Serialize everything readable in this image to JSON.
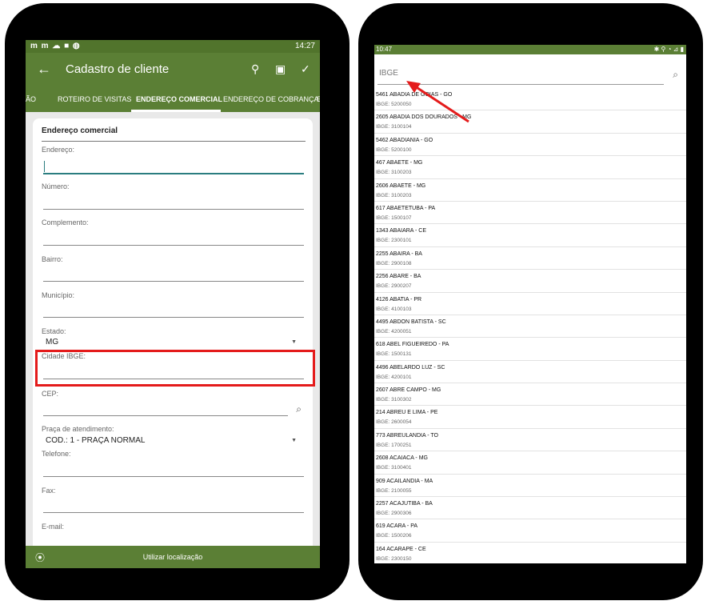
{
  "left": {
    "status": {
      "icons": "m m ☁ ■ ◍",
      "time": "14:27"
    },
    "appbar": {
      "title": "Cadastro de cliente"
    },
    "tabs": [
      "ÃO",
      "ROTEIRO DE VISITAS",
      "ENDEREÇO COMERCIAL",
      "ENDEREÇO DE COBRANÇA",
      "E"
    ],
    "section_title": "Endereço comercial",
    "fields": {
      "endereco": "Endereço:",
      "numero": "Número:",
      "complemento": "Complemento:",
      "bairro": "Bairro:",
      "municipio": "Município:",
      "estado_label": "Estado:",
      "estado_value": "MG",
      "cidade_ibge": "Cidade IBGE:",
      "cep": "CEP:",
      "praca_label": "Praça de atendimento:",
      "praca_value": "COD.: 1 - PRAÇA NORMAL",
      "telefone": "Telefone:",
      "fax": "Fax:",
      "email": "E-mail:"
    },
    "location_button": "Utilizar localização"
  },
  "right": {
    "status": {
      "time": "10:47",
      "right": "✱ ⚲ ◔ ⊿ ▮"
    },
    "search_placeholder": "IBGE",
    "cities": [
      {
        "name": "5461 ABADIA DE GOIAS - GO",
        "ibge": "IBGE: 5200050"
      },
      {
        "name": "2605 ABADIA DOS DOURADOS - MG",
        "ibge": "IBGE: 3100104"
      },
      {
        "name": "5462 ABADIANIA - GO",
        "ibge": "IBGE: 5200100"
      },
      {
        "name": "467 ABAETE - MG",
        "ibge": "IBGE: 3100203"
      },
      {
        "name": "2606 ABAETE - MG",
        "ibge": "IBGE: 3100203"
      },
      {
        "name": "617 ABAETETUBA - PA",
        "ibge": "IBGE: 1500107"
      },
      {
        "name": "1343 ABAIARA - CE",
        "ibge": "IBGE: 2300101"
      },
      {
        "name": "2255 ABAIRA - BA",
        "ibge": "IBGE: 2900108"
      },
      {
        "name": "2256 ABARE - BA",
        "ibge": "IBGE: 2900207"
      },
      {
        "name": "4126 ABATIA - PR",
        "ibge": "IBGE: 4100103"
      },
      {
        "name": "4495 ABDON BATISTA - SC",
        "ibge": "IBGE: 4200051"
      },
      {
        "name": "618 ABEL FIGUEIREDO - PA",
        "ibge": "IBGE: 1500131"
      },
      {
        "name": "4496 ABELARDO LUZ - SC",
        "ibge": "IBGE: 4200101"
      },
      {
        "name": "2607 ABRE CAMPO - MG",
        "ibge": "IBGE: 3100302"
      },
      {
        "name": "214 ABREU E LIMA - PE",
        "ibge": "IBGE: 2600054"
      },
      {
        "name": "773 ABREULANDIA - TO",
        "ibge": "IBGE: 1700251"
      },
      {
        "name": "2608 ACAIACA - MG",
        "ibge": "IBGE: 3100401"
      },
      {
        "name": "909 ACAILANDIA - MA",
        "ibge": "IBGE: 2100055"
      },
      {
        "name": "2257 ACAJUTIBA - BA",
        "ibge": "IBGE: 2900306"
      },
      {
        "name": "619 ACARA - PA",
        "ibge": "IBGE: 1500206"
      },
      {
        "name": "164 ACARAPE - CE",
        "ibge": "IBGE: 2300150"
      }
    ]
  }
}
